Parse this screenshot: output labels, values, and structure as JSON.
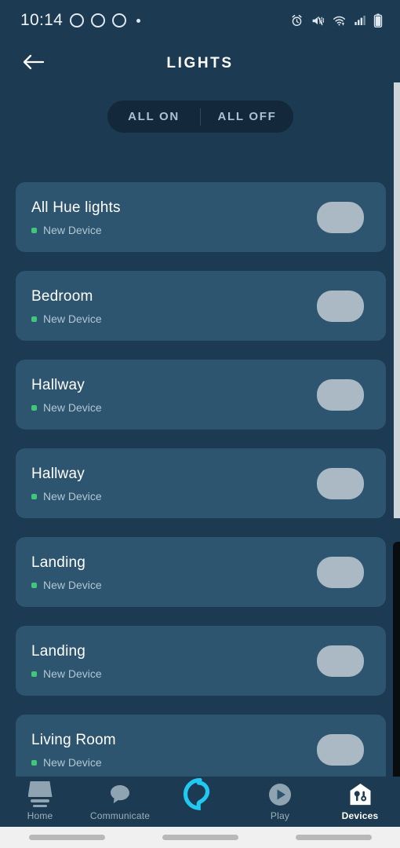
{
  "status_bar": {
    "time": "10:14",
    "left_icons": [
      "ring-icon",
      "ring-icon",
      "ring-icon",
      "dot-icon"
    ],
    "right_icons": [
      "alarm-icon",
      "mute-icon",
      "wifi-icon",
      "signal-icon",
      "battery-icon"
    ]
  },
  "header": {
    "back_icon": "back-arrow-icon",
    "title": "LIGHTS"
  },
  "group_controls": {
    "all_on_label": "ALL ON",
    "all_off_label": "ALL OFF"
  },
  "device_list": {
    "status_label": "New Device",
    "status_color": "#3ec878",
    "devices": [
      {
        "name": "All Hue lights",
        "status": "New Device",
        "toggle": "off"
      },
      {
        "name": "Bedroom",
        "status": "New Device",
        "toggle": "off"
      },
      {
        "name": "Hallway",
        "status": "New Device",
        "toggle": "off"
      },
      {
        "name": "Hallway",
        "status": "New Device",
        "toggle": "off"
      },
      {
        "name": "Landing",
        "status": "New Device",
        "toggle": "off"
      },
      {
        "name": "Landing",
        "status": "New Device",
        "toggle": "off"
      },
      {
        "name": "Living Room",
        "status": "New Device",
        "toggle": "off"
      }
    ]
  },
  "bottom_nav": {
    "items": [
      {
        "label": "Home",
        "icon": "home-icon",
        "active": false
      },
      {
        "label": "Communicate",
        "icon": "speech-bubble-icon",
        "active": false
      },
      {
        "label": "",
        "icon": "alexa-ring-icon",
        "active": false
      },
      {
        "label": "Play",
        "icon": "play-circle-icon",
        "active": false
      },
      {
        "label": "Devices",
        "icon": "house-devices-icon",
        "active": true
      }
    ]
  },
  "colors": {
    "background": "#1c3a52",
    "card": "#2d5570",
    "pill": "#13283a",
    "accent_cyan": "#21c9f0",
    "toggle_track": "#aab9c4",
    "status_green": "#3ec878"
  }
}
